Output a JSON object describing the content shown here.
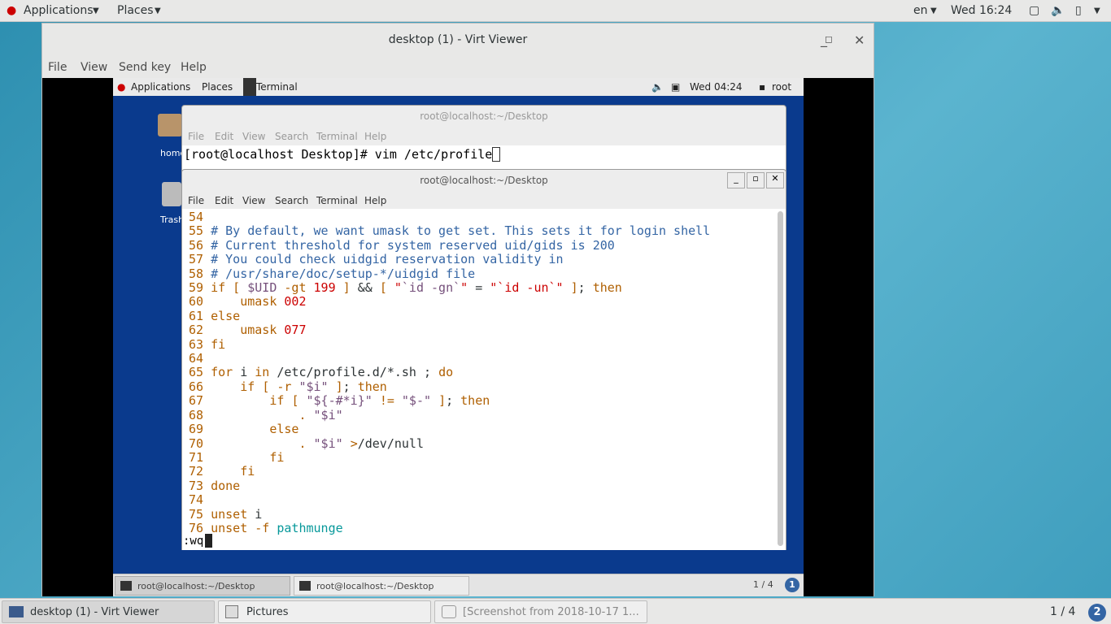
{
  "host_topbar": {
    "applications": "Applications",
    "places": "Places",
    "lang": "en",
    "clock": "Wed 16:24"
  },
  "viewer": {
    "title": "desktop (1) - Virt Viewer",
    "menu": [
      "File",
      "View",
      "Send key",
      "Help"
    ]
  },
  "guest_topbar": {
    "applications": "Applications",
    "places": "Places",
    "task": "Terminal",
    "clock": "Wed 04:24",
    "user": "root"
  },
  "desktop_icons": {
    "home": "home",
    "trash": "Trash"
  },
  "term_back": {
    "title": "root@localhost:~/Desktop",
    "menu": [
      "File",
      "Edit",
      "View",
      "Search",
      "Terminal",
      "Help"
    ],
    "prompt": "[root@localhost Desktop]# vim /etc/profile"
  },
  "term_front": {
    "title": "root@localhost:~/Desktop",
    "menu": [
      "File",
      "Edit",
      "View",
      "Search",
      "Terminal",
      "Help"
    ],
    "cmdline": ":wq"
  },
  "code_lines": [
    {
      "n": "54",
      "s": []
    },
    {
      "n": "55",
      "s": [
        [
          "cm",
          "# By default, we want umask to get set. This sets it for login shell"
        ]
      ]
    },
    {
      "n": "56",
      "s": [
        [
          "cm",
          "# Current threshold for system reserved uid/gids is 200"
        ]
      ]
    },
    {
      "n": "57",
      "s": [
        [
          "cm",
          "# You could check uidgid reservation validity in"
        ]
      ]
    },
    {
      "n": "58",
      "s": [
        [
          "cm",
          "# /usr/share/doc/setup-*/uidgid file"
        ]
      ]
    },
    {
      "n": "59",
      "s": [
        [
          "kw",
          "if ["
        ],
        [
          "tx",
          " "
        ],
        [
          "vr",
          "$UID"
        ],
        [
          "tx",
          " "
        ],
        [
          "kw",
          "-gt"
        ],
        [
          "tx",
          " "
        ],
        [
          "nm",
          "199"
        ],
        [
          "tx",
          " "
        ],
        [
          "kw",
          "]"
        ],
        [
          "tx",
          " && "
        ],
        [
          "kw",
          "["
        ],
        [
          "tx",
          " "
        ],
        [
          "nm",
          "\""
        ],
        [
          "vr",
          "`id -gn`"
        ],
        [
          "nm",
          "\""
        ],
        [
          "tx",
          " = "
        ],
        [
          "nm",
          "\"`id -un`\""
        ],
        [
          "tx",
          " "
        ],
        [
          "kw",
          "]"
        ],
        [
          "tx",
          "; "
        ],
        [
          "kw",
          "then"
        ]
      ]
    },
    {
      "n": "60",
      "s": [
        [
          "tx",
          "    "
        ],
        [
          "kw",
          "umask"
        ],
        [
          "tx",
          " "
        ],
        [
          "nm",
          "002"
        ]
      ]
    },
    {
      "n": "61",
      "s": [
        [
          "kw",
          "else"
        ]
      ]
    },
    {
      "n": "62",
      "s": [
        [
          "tx",
          "    "
        ],
        [
          "kw",
          "umask"
        ],
        [
          "tx",
          " "
        ],
        [
          "nm",
          "077"
        ]
      ]
    },
    {
      "n": "63",
      "s": [
        [
          "kw",
          "fi"
        ]
      ]
    },
    {
      "n": "64",
      "s": []
    },
    {
      "n": "65",
      "s": [
        [
          "kw",
          "for"
        ],
        [
          "tx",
          " i "
        ],
        [
          "kw",
          "in"
        ],
        [
          "tx",
          " /etc/profile.d/*.sh ; "
        ],
        [
          "kw",
          "do"
        ]
      ]
    },
    {
      "n": "66",
      "s": [
        [
          "tx",
          "    "
        ],
        [
          "kw",
          "if"
        ],
        [
          "tx",
          " "
        ],
        [
          "kw",
          "["
        ],
        [
          "tx",
          " "
        ],
        [
          "kw",
          "-r"
        ],
        [
          "tx",
          " "
        ],
        [
          "vr",
          "\"$i\""
        ],
        [
          "tx",
          " "
        ],
        [
          "kw",
          "]"
        ],
        [
          "tx",
          "; "
        ],
        [
          "kw",
          "then"
        ]
      ]
    },
    {
      "n": "67",
      "s": [
        [
          "tx",
          "        "
        ],
        [
          "kw",
          "if"
        ],
        [
          "tx",
          " "
        ],
        [
          "kw",
          "["
        ],
        [
          "tx",
          " "
        ],
        [
          "vr",
          "\"${-#*i}\""
        ],
        [
          "tx",
          " "
        ],
        [
          "kw",
          "!="
        ],
        [
          "tx",
          " "
        ],
        [
          "vr",
          "\"$-\""
        ],
        [
          "tx",
          " "
        ],
        [
          "kw",
          "]"
        ],
        [
          "tx",
          "; "
        ],
        [
          "kw",
          "then"
        ]
      ]
    },
    {
      "n": "68",
      "s": [
        [
          "tx",
          "            "
        ],
        [
          "kw",
          "."
        ],
        [
          "tx",
          " "
        ],
        [
          "vr",
          "\"$i\""
        ]
      ]
    },
    {
      "n": "69",
      "s": [
        [
          "tx",
          "        "
        ],
        [
          "kw",
          "else"
        ]
      ]
    },
    {
      "n": "70",
      "s": [
        [
          "tx",
          "            "
        ],
        [
          "kw",
          "."
        ],
        [
          "tx",
          " "
        ],
        [
          "vr",
          "\"$i\""
        ],
        [
          "tx",
          " "
        ],
        [
          "kw",
          ">"
        ],
        [
          "tx",
          "/dev/null"
        ]
      ]
    },
    {
      "n": "71",
      "s": [
        [
          "tx",
          "        "
        ],
        [
          "kw",
          "fi"
        ]
      ]
    },
    {
      "n": "72",
      "s": [
        [
          "tx",
          "    "
        ],
        [
          "kw",
          "fi"
        ]
      ]
    },
    {
      "n": "73",
      "s": [
        [
          "kw",
          "done"
        ]
      ]
    },
    {
      "n": "74",
      "s": []
    },
    {
      "n": "75",
      "s": [
        [
          "kw",
          "unset"
        ],
        [
          "tx",
          " i"
        ]
      ]
    },
    {
      "n": "76",
      "s": [
        [
          "kw",
          "unset"
        ],
        [
          "tx",
          " "
        ],
        [
          "kw",
          "-f"
        ],
        [
          "tx",
          " "
        ],
        [
          "cy",
          "pathmunge"
        ]
      ]
    }
  ],
  "guest_taskbar": {
    "items": [
      "root@localhost:~/Desktop",
      "root@localhost:~/Desktop"
    ],
    "pager": "1 / 4",
    "badge": "1"
  },
  "host_taskbar": {
    "items": [
      "desktop (1) - Virt Viewer",
      "Pictures",
      "[Screenshot from 2018-10-17 1..."
    ],
    "pager": "1 / 4",
    "badge": "2"
  }
}
